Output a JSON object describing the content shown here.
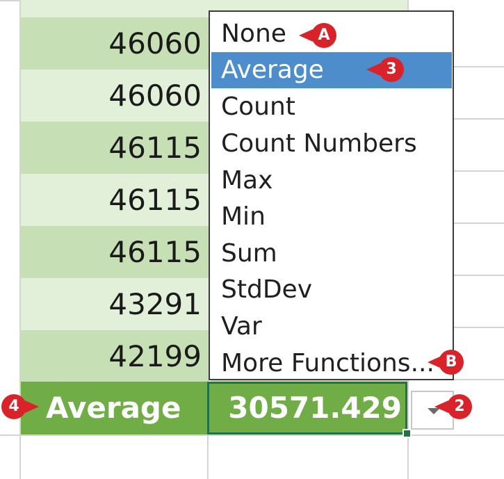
{
  "table": {
    "rows": [
      {
        "value": "46060"
      },
      {
        "value": "46060"
      },
      {
        "value": "46115"
      },
      {
        "value": "46115"
      },
      {
        "value": "46115"
      },
      {
        "value": "43291"
      },
      {
        "value": "42199"
      }
    ],
    "total": {
      "label": "Average",
      "value": "30571.429"
    }
  },
  "menu": {
    "items": [
      {
        "label": "None",
        "selected": false
      },
      {
        "label": "Average",
        "selected": true
      },
      {
        "label": "Count",
        "selected": false
      },
      {
        "label": "Count Numbers",
        "selected": false
      },
      {
        "label": "Max",
        "selected": false
      },
      {
        "label": "Min",
        "selected": false
      },
      {
        "label": "Sum",
        "selected": false
      },
      {
        "label": "StdDev",
        "selected": false
      },
      {
        "label": "Var",
        "selected": false
      },
      {
        "label": "More Functions...",
        "selected": false
      }
    ]
  },
  "callouts": {
    "a": "A",
    "b": "B",
    "two": "2",
    "three": "3",
    "four": "4"
  },
  "colors": {
    "band_dark": "#c6dfb4",
    "band_light": "#e2efd9",
    "total_row": "#70ad47",
    "selected_item": "#4e8dcc",
    "callout": "#d8232a",
    "active_border": "#217346"
  }
}
